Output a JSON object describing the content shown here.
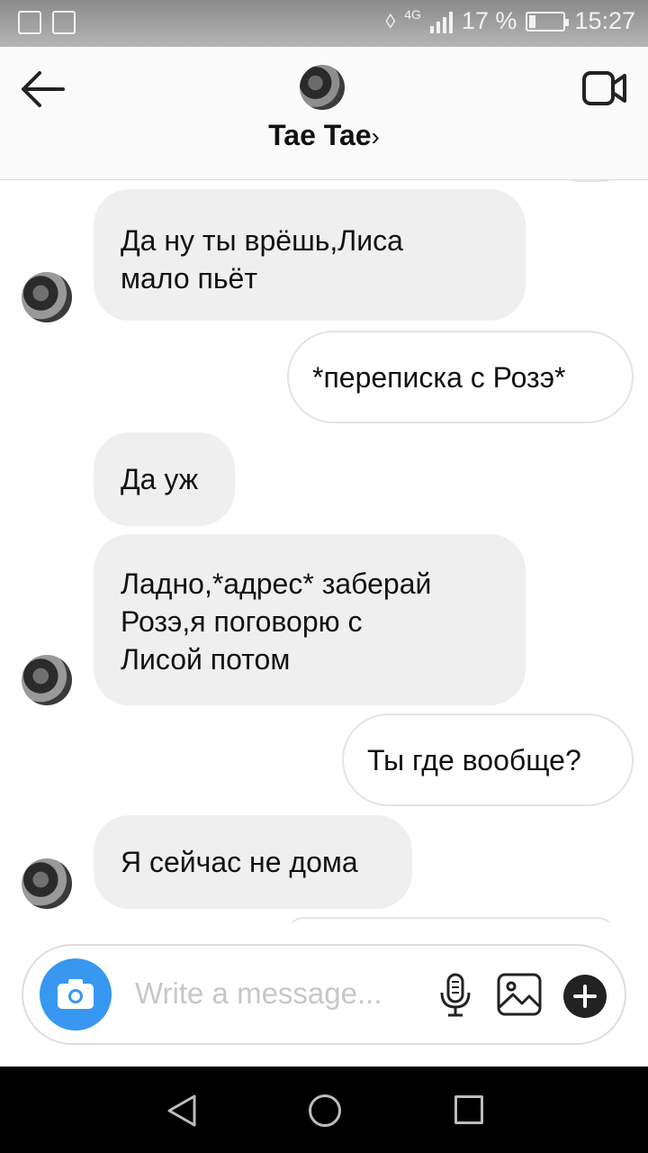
{
  "status_bar": {
    "network": "4G",
    "battery_percent": "17 %",
    "battery_level": 0.17,
    "time": "15:27"
  },
  "header": {
    "contact_name": "Tae Tae",
    "chevron": "›",
    "icons": [
      "back-arrow-icon",
      "video-call-icon"
    ]
  },
  "messages": [
    {
      "side": "in",
      "text_lines": [
        "Да ну ты врёшь,Лиса",
        "мало пьёт"
      ]
    },
    {
      "side": "out",
      "text_lines": [
        "*переписка с Розэ*"
      ]
    },
    {
      "side": "in",
      "text_lines": [
        "Да уж"
      ]
    },
    {
      "side": "in",
      "text_lines": [
        "Ладно,*адрес* заберай",
        "Розэ,я поговорю с",
        "Лисой потом"
      ]
    },
    {
      "side": "out",
      "text_lines": [
        "Ты где вообще?"
      ]
    },
    {
      "side": "in",
      "text_lines": [
        "Я сейчас не дома"
      ]
    }
  ],
  "composer": {
    "placeholder": "Write a message...",
    "icons": [
      "camera-icon",
      "microphone-icon",
      "gallery-icon",
      "plus-icon"
    ]
  },
  "navigation": {
    "icons": [
      "back-triangle-icon",
      "home-circle-icon",
      "recents-square-icon"
    ]
  }
}
